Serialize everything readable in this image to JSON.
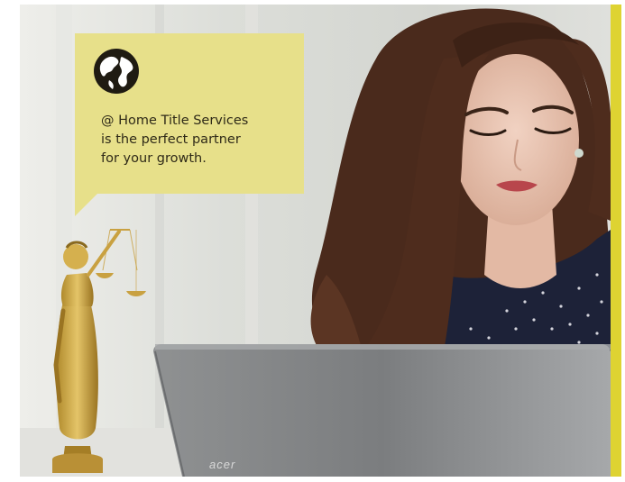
{
  "callout": {
    "icon": "globe-icon",
    "lines": [
      "@ Home Title Services",
      "is the perfect partner",
      "for your growth."
    ]
  },
  "laptop": {
    "brand": "acer"
  },
  "colors": {
    "accent_yellow": "#ded332",
    "callout_background": "#e7e08a",
    "text": "#2f2a18"
  }
}
